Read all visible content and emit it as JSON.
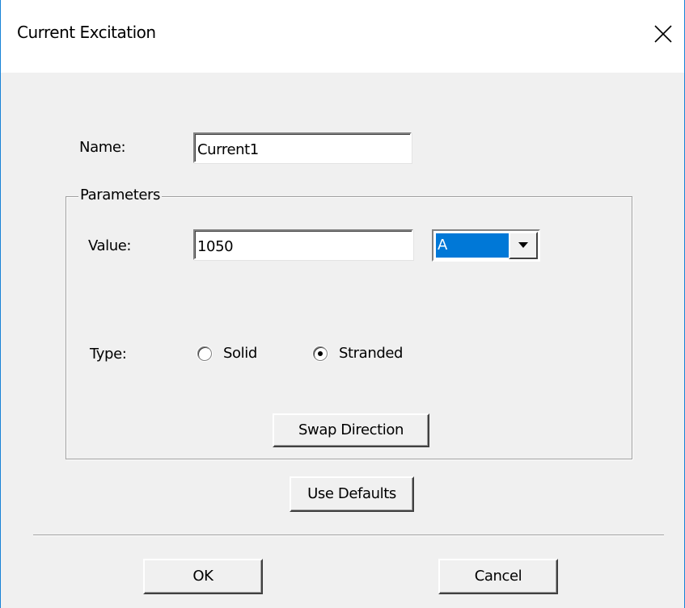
{
  "dialog": {
    "title": "Current Excitation"
  },
  "name_field": {
    "label": "Name:",
    "value": "Current1"
  },
  "parameters": {
    "legend": "Parameters",
    "value_label": "Value:",
    "value": "1050",
    "unit_selected": "A",
    "type_label": "Type:",
    "type_options": [
      {
        "label": "Solid",
        "selected": false
      },
      {
        "label": "Stranded",
        "selected": true
      }
    ],
    "swap_direction_label": "Swap Direction"
  },
  "use_defaults_label": "Use Defaults",
  "footer": {
    "ok_label": "OK",
    "cancel_label": "Cancel"
  },
  "icons": {
    "close": "close-icon",
    "dropdown": "chevron-down-icon"
  },
  "colors": {
    "accent": "#0078d7",
    "window_border": "#1883d7",
    "face": "#f0f0f0"
  }
}
